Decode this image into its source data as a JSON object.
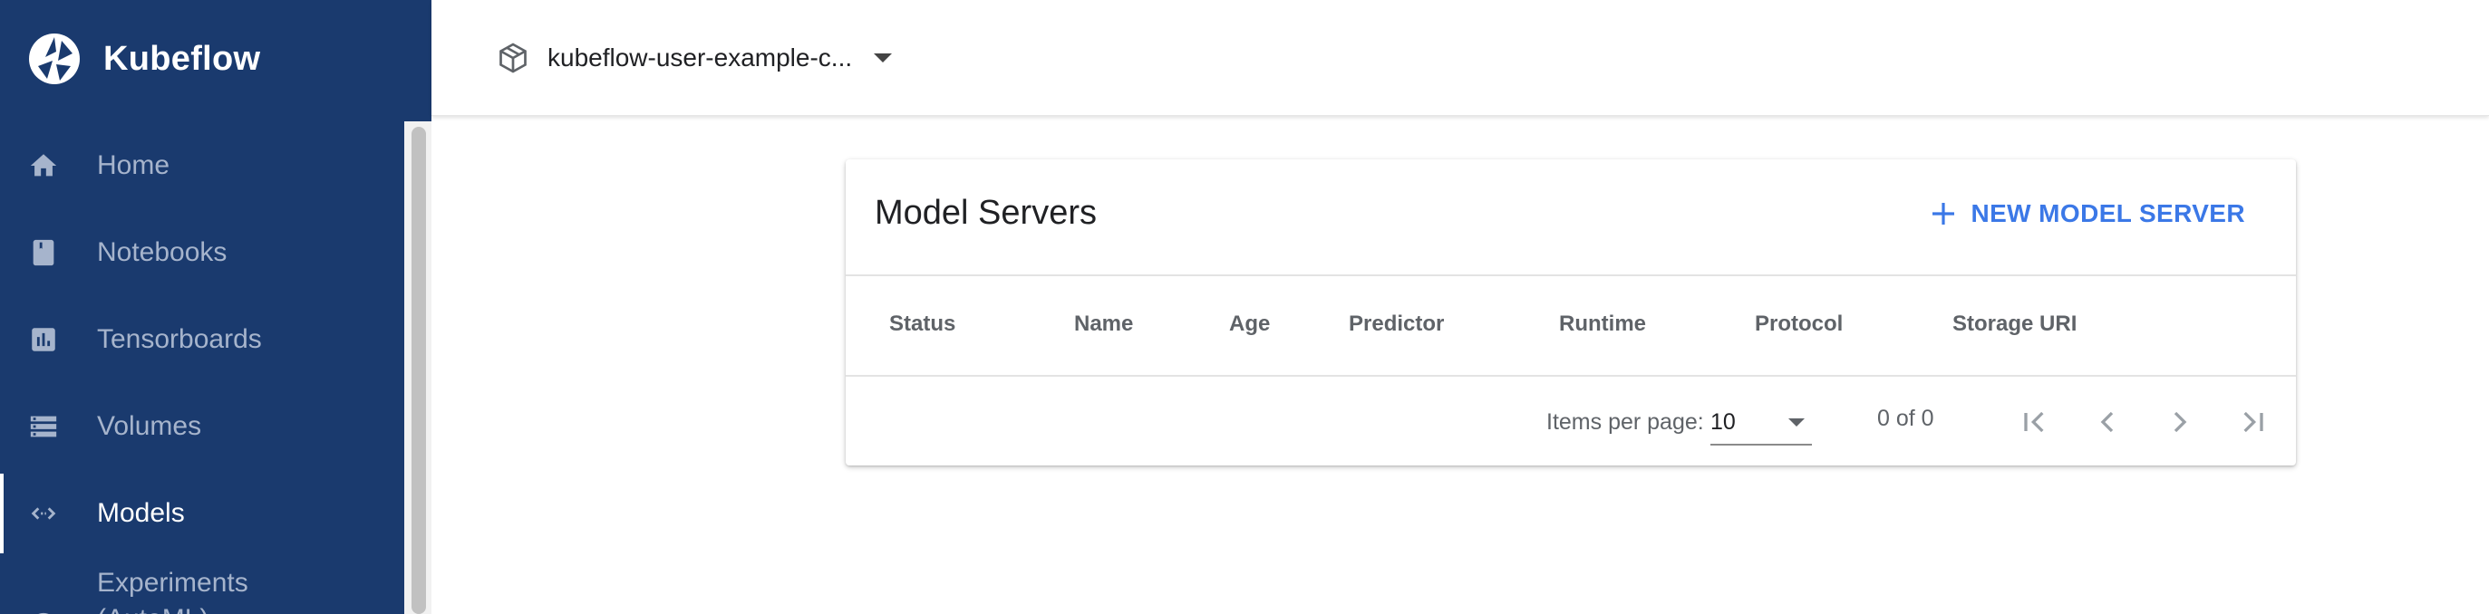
{
  "app": {
    "brand": "Kubeflow",
    "namespace": "kubeflow-user-example-c...",
    "colors": {
      "sidebar": "#1a3a6e",
      "accent": "#3b78e7"
    }
  },
  "sidebar": {
    "items": [
      {
        "label": "Home",
        "icon": "home-icon"
      },
      {
        "label": "Notebooks",
        "icon": "notebook-icon"
      },
      {
        "label": "Tensorboards",
        "icon": "chart-icon"
      },
      {
        "label": "Volumes",
        "icon": "storage-icon"
      },
      {
        "label": "Models",
        "icon": "code-arrows-icon",
        "active": true
      },
      {
        "label": "Experiments",
        "label2": "(AutoML)",
        "icon": "experiments-icon"
      }
    ]
  },
  "main": {
    "title": "Model Servers",
    "new_button": "NEW MODEL SERVER",
    "columns": [
      "Status",
      "Name",
      "Age",
      "Predictor",
      "Runtime",
      "Protocol",
      "Storage URI"
    ],
    "paginator": {
      "items_per_page_label": "Items per page:",
      "items_per_page": "10",
      "range": "0 of 0"
    }
  }
}
